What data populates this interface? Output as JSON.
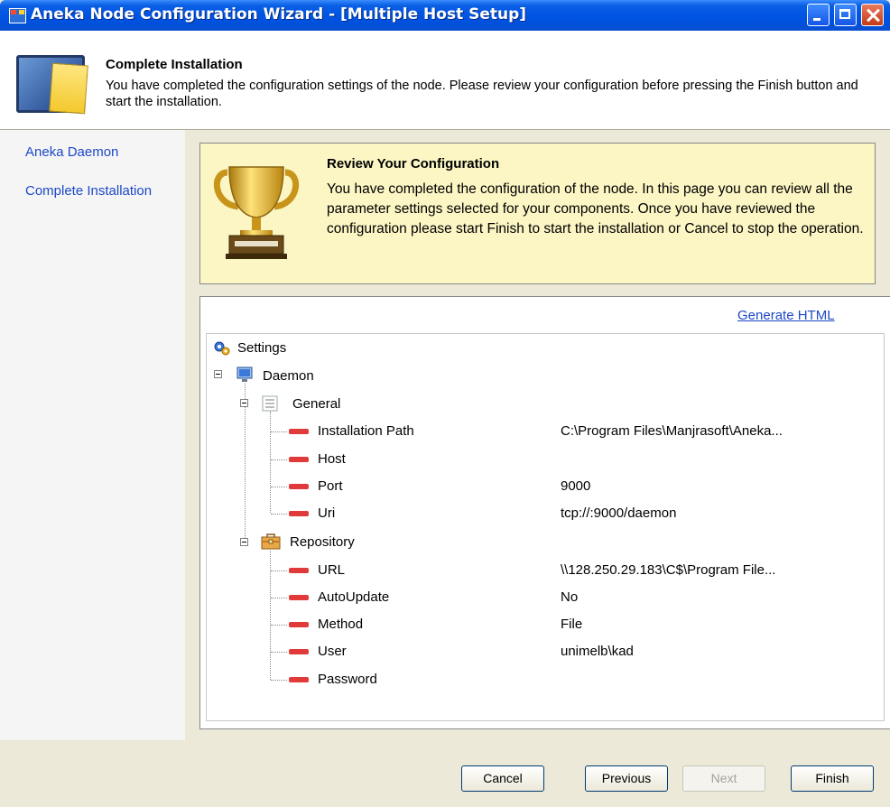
{
  "window": {
    "title": "Aneka Node Configuration Wizard - [Multiple Host Setup]"
  },
  "header": {
    "title": "Complete Installation",
    "description": "You have completed the configuration settings of the node. Please review your configuration before pressing the Finish button and start the installation."
  },
  "nav": {
    "items": [
      {
        "label": "Aneka Daemon"
      },
      {
        "label": "Complete Installation"
      }
    ]
  },
  "review": {
    "title": "Review Your Configuration",
    "text": "You have completed the configuration of the node. In this page you can review all the parameter settings selected for your components. Once you have reviewed the configuration please start Finish to start the installation or Cancel to stop the operation."
  },
  "panel": {
    "link": "Generate HTML"
  },
  "tree": {
    "root": "Settings",
    "daemon": "Daemon",
    "general": {
      "label": "General",
      "items": [
        {
          "name": "Installation Path",
          "value": "C:\\Program Files\\Manjrasoft\\Aneka..."
        },
        {
          "name": "Host",
          "value": ""
        },
        {
          "name": "Port",
          "value": "9000"
        },
        {
          "name": "Uri",
          "value": "tcp://:9000/daemon"
        }
      ]
    },
    "repository": {
      "label": "Repository",
      "items": [
        {
          "name": "URL",
          "value": "\\\\128.250.29.183\\C$\\Program File..."
        },
        {
          "name": "AutoUpdate",
          "value": "No"
        },
        {
          "name": "Method",
          "value": "File"
        },
        {
          "name": "User",
          "value": "unimelb\\kad"
        },
        {
          "name": "Password",
          "value": ""
        }
      ]
    }
  },
  "buttons": {
    "cancel": "Cancel",
    "previous": "Previous",
    "next": "Next",
    "finish": "Finish"
  }
}
